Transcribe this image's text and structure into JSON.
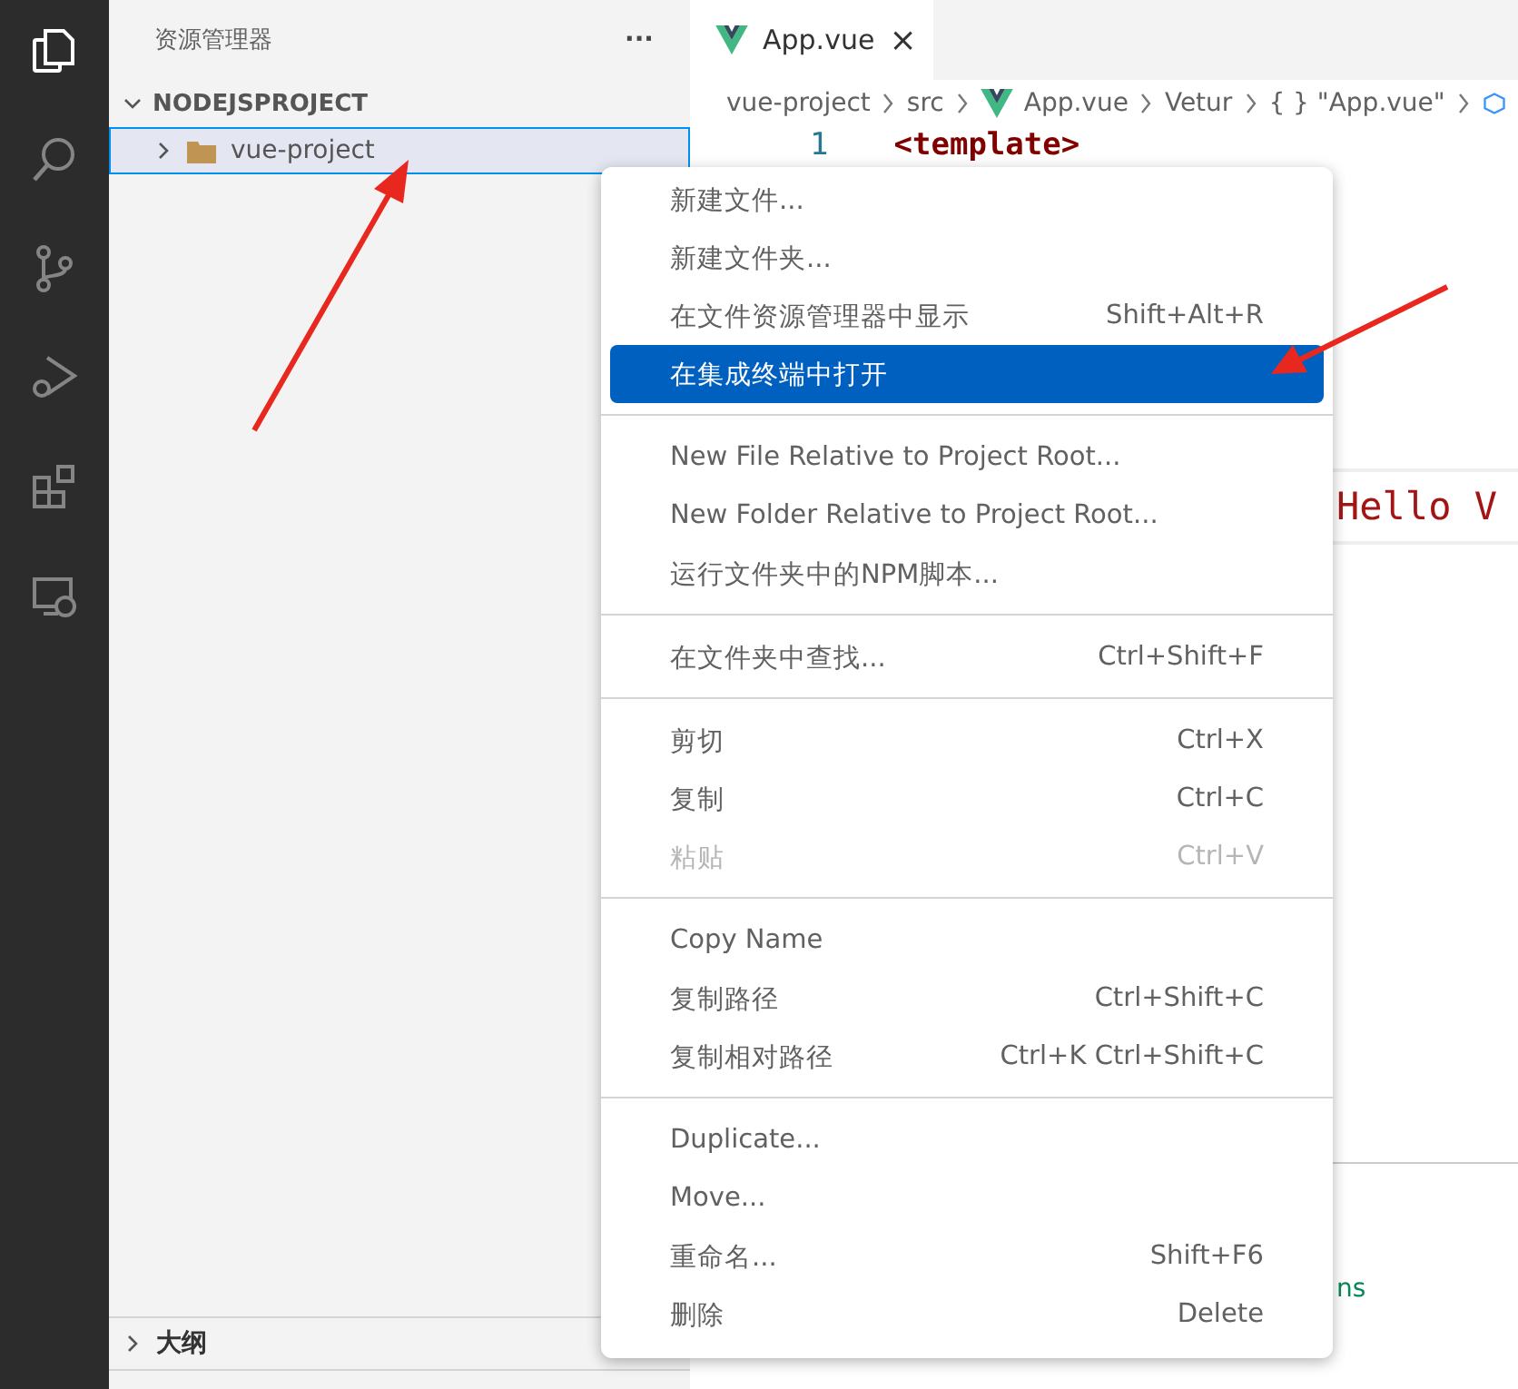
{
  "sidebar": {
    "title": "资源管理器",
    "more": "···",
    "section": {
      "label": "NODEJSPROJECT",
      "expanded": true
    },
    "items": [
      {
        "label": "vue-project",
        "expanded": false,
        "selected": true
      }
    ],
    "outline": {
      "label": "大纲",
      "expanded": false
    }
  },
  "tabs": [
    {
      "label": "App.vue",
      "close": "×",
      "selected": true
    }
  ],
  "breadcrumbs": [
    "vue-project",
    "src",
    "App.vue",
    "Vetur",
    "{ } \"App.vue\""
  ],
  "editor": {
    "line_number": "1",
    "line_text": "<template>",
    "hello": "Hello V",
    "fragment": "ns"
  },
  "context_menu": [
    {
      "kind": "item",
      "label": "新建文件...",
      "selected": false,
      "disabled": false
    },
    {
      "kind": "item",
      "label": "新建文件夹...",
      "selected": false,
      "disabled": false
    },
    {
      "kind": "item",
      "label": "在文件资源管理器中显示",
      "shortcut": "Shift+Alt+R",
      "selected": false,
      "disabled": false
    },
    {
      "kind": "item",
      "label": "在集成终端中打开",
      "selected": true,
      "disabled": false
    },
    {
      "kind": "separator"
    },
    {
      "kind": "item",
      "label": "New File Relative to Project Root...",
      "selected": false,
      "disabled": false
    },
    {
      "kind": "item",
      "label": "New Folder Relative to Project Root...",
      "selected": false,
      "disabled": false
    },
    {
      "kind": "item",
      "label": "运行文件夹中的NPM脚本...",
      "selected": false,
      "disabled": false
    },
    {
      "kind": "separator"
    },
    {
      "kind": "item",
      "label": "在文件夹中查找...",
      "shortcut": "Ctrl+Shift+F",
      "selected": false,
      "disabled": false
    },
    {
      "kind": "separator"
    },
    {
      "kind": "item",
      "label": "剪切",
      "shortcut": "Ctrl+X",
      "selected": false,
      "disabled": false
    },
    {
      "kind": "item",
      "label": "复制",
      "shortcut": "Ctrl+C",
      "selected": false,
      "disabled": false
    },
    {
      "kind": "item",
      "label": "粘贴",
      "shortcut": "Ctrl+V",
      "selected": false,
      "disabled": true
    },
    {
      "kind": "separator"
    },
    {
      "kind": "item",
      "label": "Copy Name",
      "selected": false,
      "disabled": false
    },
    {
      "kind": "item",
      "label": "复制路径",
      "shortcut": "Ctrl+Shift+C",
      "selected": false,
      "disabled": false
    },
    {
      "kind": "item",
      "label": "复制相对路径",
      "shortcut": "Ctrl+K Ctrl+Shift+C",
      "selected": false,
      "disabled": false
    },
    {
      "kind": "separator"
    },
    {
      "kind": "item",
      "label": "Duplicate...",
      "selected": false,
      "disabled": false
    },
    {
      "kind": "item",
      "label": "Move...",
      "selected": false,
      "disabled": false
    },
    {
      "kind": "item",
      "label": "重命名...",
      "shortcut": "Shift+F6",
      "selected": false,
      "disabled": false
    },
    {
      "kind": "item",
      "label": "删除",
      "shortcut": "Delete",
      "selected": false,
      "disabled": false
    }
  ]
}
